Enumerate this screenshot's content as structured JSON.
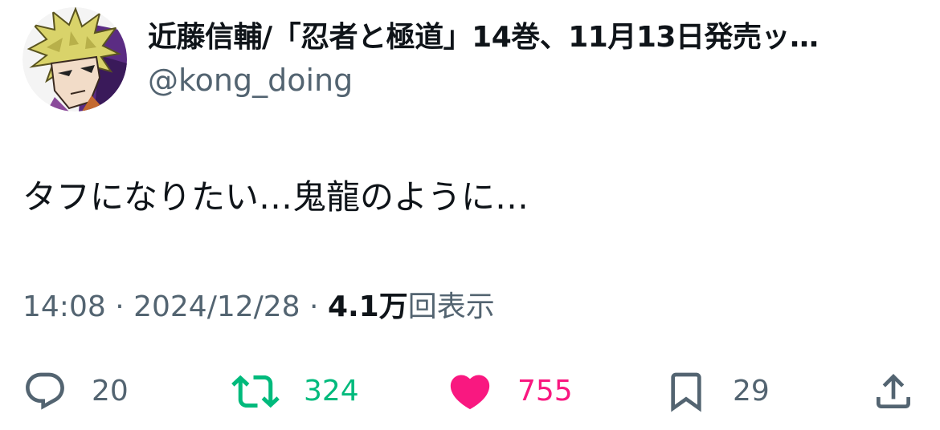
{
  "author": {
    "display_name": "近藤信輔/「忍者と極道」14巻、11月13日発売ッ…",
    "handle": "@kong_doing",
    "avatar_icon": "manga-character-avatar-icon"
  },
  "tweet": {
    "text": "タフになりたい…鬼龍のように…"
  },
  "meta": {
    "time": "14:08",
    "separator": " · ",
    "date": "2024/12/28",
    "views_count": "4.1万",
    "views_label": "回表示"
  },
  "actions": {
    "reply": {
      "icon": "reply-icon",
      "count": "20"
    },
    "retweet": {
      "icon": "retweet-icon",
      "count": "324",
      "color": "#00ba7c"
    },
    "like": {
      "icon": "heart-icon",
      "count": "755",
      "color": "#f91880",
      "active": true
    },
    "bookmark": {
      "icon": "bookmark-icon",
      "count": "29"
    },
    "share": {
      "icon": "share-icon"
    }
  }
}
